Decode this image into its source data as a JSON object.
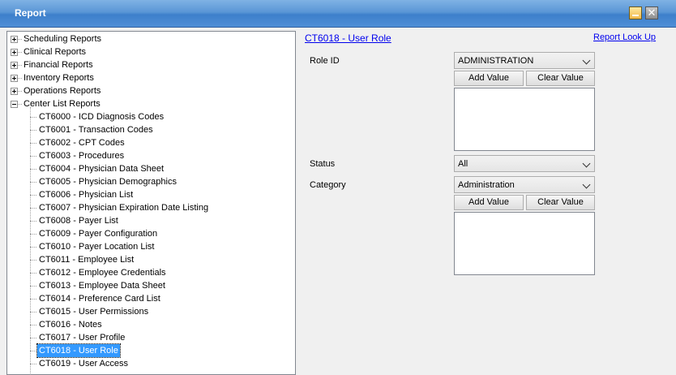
{
  "window": {
    "title": "Report"
  },
  "tree": {
    "groups": [
      {
        "label": "Scheduling Reports",
        "expanded": false
      },
      {
        "label": "Clinical Reports",
        "expanded": false
      },
      {
        "label": "Financial Reports",
        "expanded": false
      },
      {
        "label": "Inventory Reports",
        "expanded": false
      },
      {
        "label": "Operations Reports",
        "expanded": false
      },
      {
        "label": "Center List Reports",
        "expanded": true
      }
    ],
    "children": [
      "CT6000 - ICD Diagnosis Codes",
      "CT6001 - Transaction Codes",
      "CT6002 - CPT Codes",
      "CT6003 - Procedures",
      "CT6004 - Physician Data Sheet",
      "CT6005 - Physician Demographics",
      "CT6006 - Physician List",
      "CT6007 - Physician Expiration Date Listing",
      "CT6008 - Payer List",
      "CT6009 - Payer Configuration",
      "CT6010 - Payer Location List",
      "CT6011 - Employee List",
      "CT6012 - Employee Credentials",
      "CT6013 - Employee Data Sheet",
      "CT6014 - Preference Card List",
      "CT6015 - User Permissions",
      "CT6016 - Notes",
      "CT6017 - User Profile",
      "CT6018 - User Role",
      "CT6019 - User Access"
    ],
    "selected": "CT6018 - User Role"
  },
  "report": {
    "title": "CT6018 - User Role",
    "lookup_link": "Report Look Up",
    "role_id": {
      "label": "Role ID",
      "value": "ADMINISTRATION",
      "add": "Add Value",
      "clear": "Clear Value"
    },
    "status": {
      "label": "Status",
      "value": "All"
    },
    "category": {
      "label": "Category",
      "value": "Administration",
      "add": "Add Value",
      "clear": "Clear Value"
    }
  }
}
